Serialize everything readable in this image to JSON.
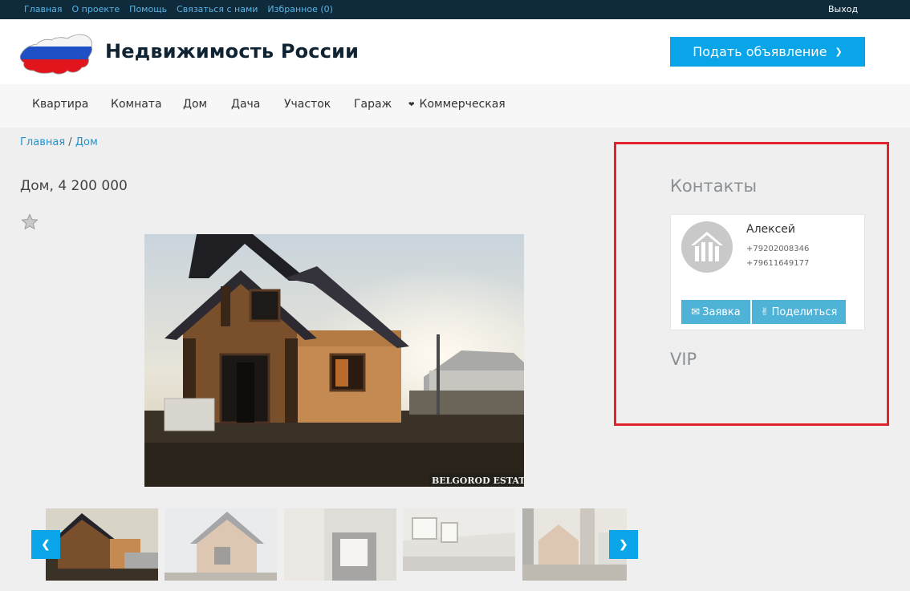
{
  "topbar": {
    "links": [
      "Главная",
      "О проекте",
      "Помощь",
      "Связаться с нами",
      "Избранное (0)"
    ],
    "logout": "Выход"
  },
  "header": {
    "title": "Недвижимость России",
    "post_button": "Подать объявление"
  },
  "nav": {
    "items": [
      "Квартира",
      "Комната",
      "Дом",
      "Дача",
      "Участок",
      "Гараж",
      "Коммерческая"
    ]
  },
  "breadcrumb": {
    "home": "Главная",
    "separator": "/",
    "current": "Дом"
  },
  "listing": {
    "title": "Дом, 4 200 000",
    "watermark": "BELGOROD ESTATE"
  },
  "contacts": {
    "title": "Контакты",
    "name": "Алексей",
    "phones": [
      "+79202008346",
      "+79611649177"
    ],
    "request_button": "Заявка",
    "share_button": "Поделиться"
  },
  "vip": {
    "title": "VIP"
  },
  "colors": {
    "accent": "#0aa5e8",
    "highlight": "#e3212b",
    "topbar": "#0e2a3b"
  }
}
